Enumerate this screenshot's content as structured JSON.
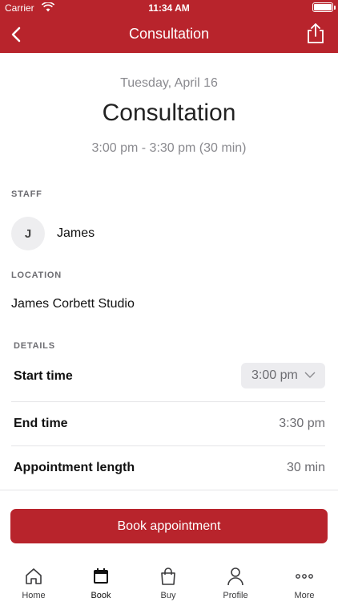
{
  "status_bar": {
    "carrier": "Carrier",
    "time": "11:34 AM"
  },
  "nav": {
    "title": "Consultation",
    "back_icon": "chevron-left-icon",
    "share_icon": "share-icon"
  },
  "appointment": {
    "date": "Tuesday, April 16",
    "title": "Consultation",
    "time_range": "3:00 pm - 3:30 pm (30 min)"
  },
  "staff": {
    "section_label": "STAFF",
    "initial": "J",
    "name": "James"
  },
  "location": {
    "section_label": "LOCATION",
    "name": "James Corbett Studio"
  },
  "details": {
    "section_label": "DETAILS",
    "start_time_label": "Start time",
    "start_time_value": "3:00 pm",
    "end_time_label": "End time",
    "end_time_value": "3:30 pm",
    "length_label": "Appointment length",
    "length_value": "30 min"
  },
  "book_button_label": "Book appointment",
  "tabs": [
    {
      "label": "Home",
      "icon": "home-icon"
    },
    {
      "label": "Book",
      "icon": "calendar-icon",
      "active": true
    },
    {
      "label": "Buy",
      "icon": "shopping-bag-icon"
    },
    {
      "label": "Profile",
      "icon": "person-icon"
    },
    {
      "label": "More",
      "icon": "more-dots-icon"
    }
  ],
  "colors": {
    "brand": "#b8242c",
    "muted_text": "#8a8a8f",
    "divider": "#e4e4e7"
  }
}
